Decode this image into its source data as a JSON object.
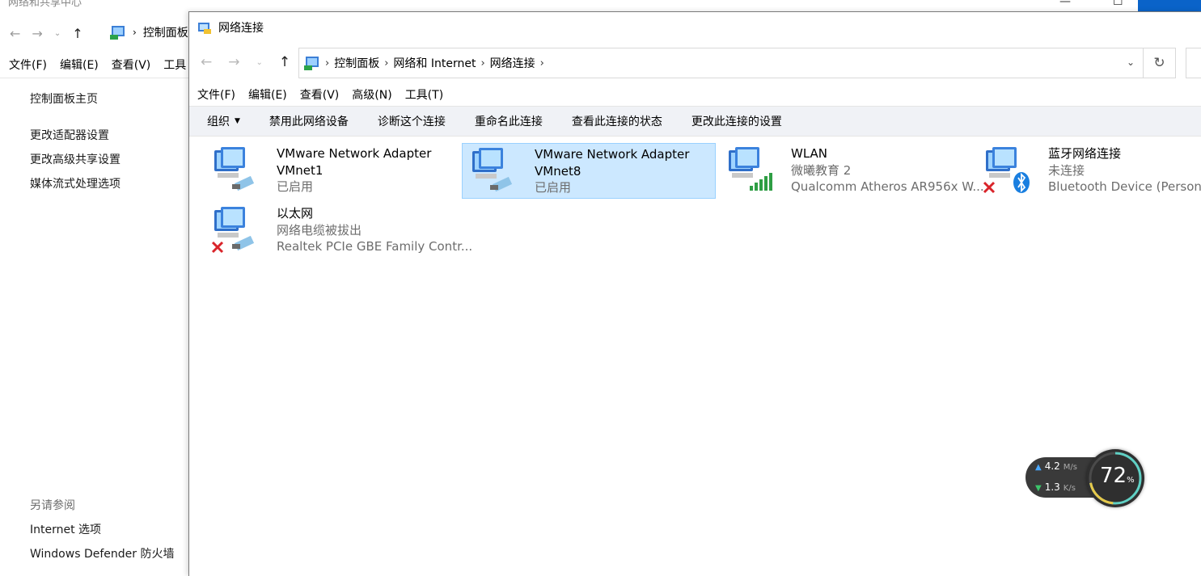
{
  "back_window": {
    "title": "网络和共享中心",
    "breadcrumb": "控制面板",
    "menu": [
      "文件(F)",
      "编辑(E)",
      "查看(V)",
      "工具"
    ],
    "sidebar_main": "控制面板主页",
    "sidebar_links": [
      "更改适配器设置",
      "更改高级共享设置",
      "媒体流式处理选项"
    ],
    "see_also_heading": "另请参阅",
    "see_also_links": [
      "Internet 选项",
      "Windows Defender 防火墙"
    ]
  },
  "window": {
    "title": "网络连接",
    "breadcrumb": [
      "控制面板",
      "网络和 Internet",
      "网络连接"
    ],
    "menu": [
      "文件(F)",
      "编辑(E)",
      "查看(V)",
      "高级(N)",
      "工具(T)"
    ],
    "commands": [
      "组织",
      "禁用此网络设备",
      "诊断这个连接",
      "重命名此连接",
      "查看此连接的状态",
      "更改此连接的设置"
    ]
  },
  "connections": [
    {
      "name": "VMware Network Adapter",
      "line2": "VMnet1",
      "line3": "已启用",
      "icon": "network-cable-icon",
      "selected": false
    },
    {
      "name": "VMware Network Adapter",
      "line2": "VMnet8",
      "line3": "已启用",
      "icon": "network-cable-icon",
      "selected": true
    },
    {
      "name": "WLAN",
      "line2": "微曦教育 2",
      "line3": "Qualcomm Atheros AR956x W...",
      "icon": "wifi-signal-icon",
      "selected": false
    },
    {
      "name": "蓝牙网络连接",
      "line2": "未连接",
      "line3": "Bluetooth Device (Personal A",
      "icon": "bluetooth-icon",
      "selected": false
    },
    {
      "name": "以太网",
      "line2": "网络电缆被拔出",
      "line3": "Realtek PCIe GBE Family Contr...",
      "icon": "network-cable-icon",
      "selected": false
    }
  ],
  "widget": {
    "upload": "4.2",
    "upload_unit": "M/s",
    "download": "1.3",
    "download_unit": "K/s",
    "percent": "72",
    "percent_sign": "%"
  },
  "colors": {
    "selection_bg": "#cce8ff",
    "selection_border": "#99d1ff",
    "command_bar": "#f0f2f6",
    "accent_blue": "#0a63c9"
  }
}
